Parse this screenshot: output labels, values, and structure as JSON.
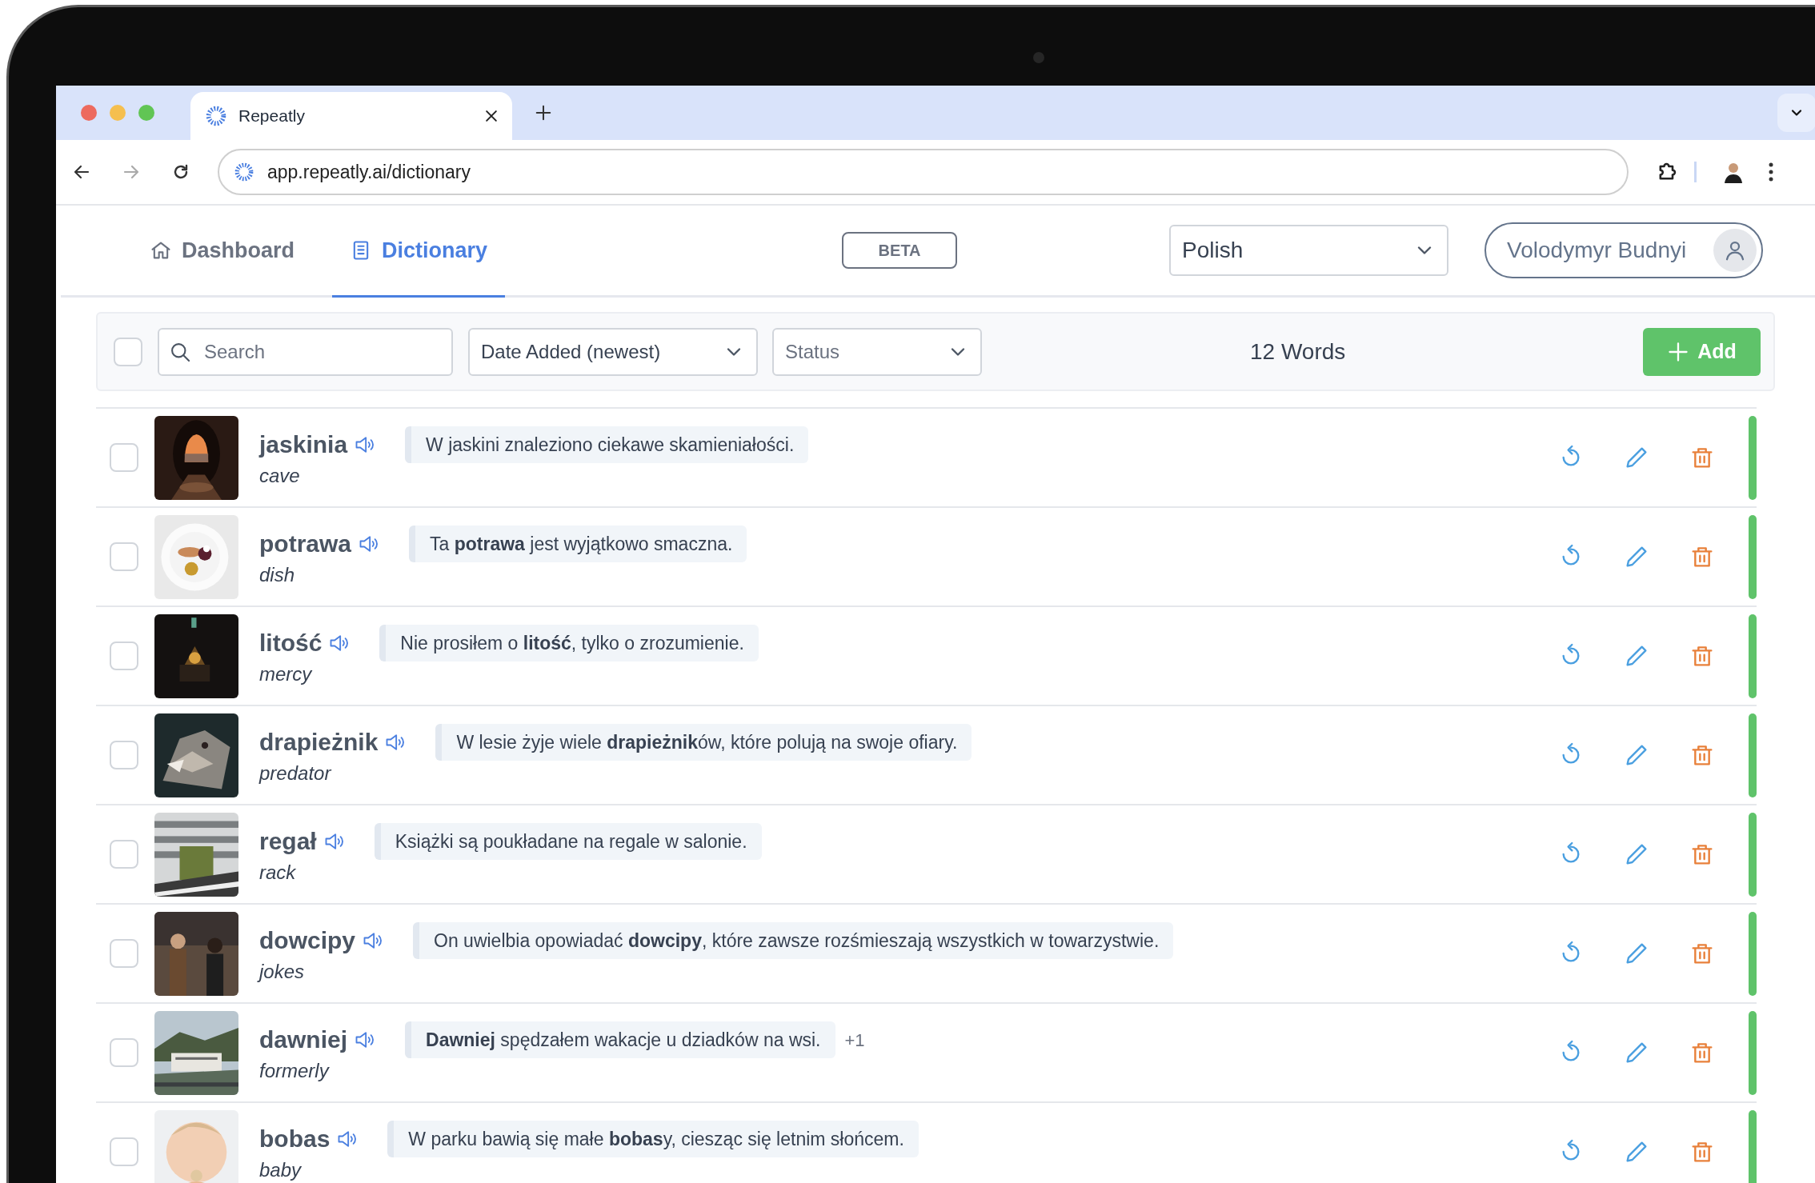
{
  "browser": {
    "tab": {
      "title": "Repeatly"
    },
    "url": "app.repeatly.ai/dictionary"
  },
  "nav": {
    "items": [
      {
        "label": "Dashboard",
        "kind": "home",
        "selected": false
      },
      {
        "label": "Dictionary",
        "kind": "book",
        "selected": true
      }
    ],
    "badge": "BETA",
    "language": "Polish",
    "user": "Volodymyr Budnyi"
  },
  "toolbar": {
    "select_all_checked": false,
    "search": {
      "placeholder": "Search"
    },
    "sort": "Date Added (newest)",
    "status": {
      "placeholder": "Status"
    },
    "count": "12 Words",
    "add_button": "Add"
  },
  "words": [
    {
      "word": "jaskinia",
      "translation": "cave",
      "example": "W jaskini znaleziono ciekawe skamieniałości.",
      "checked": false,
      "color": "#5fc36a"
    },
    {
      "word": "potrawa",
      "translation": "dish",
      "example": "Ta **potrawa** jest wyjątkowo smaczna.",
      "checked": false,
      "color": "#5fc36a"
    },
    {
      "word": "litość",
      "translation": "mercy",
      "example": "Nie prosiłem o **litość**, tylko o zrozumienie.",
      "checked": false,
      "color": "#5fc36a"
    },
    {
      "word": "drapieżnik",
      "translation": "predator",
      "example": "W lesie żyje wiele **drapieżnik**ów, które polują na swoje ofiary.",
      "checked": false,
      "color": "#5fc36a"
    },
    {
      "word": "regał",
      "translation": "rack",
      "example": "Książki są poukładane na regale w salonie.",
      "checked": false,
      "color": "#5fc36a"
    },
    {
      "word": "dowcipy",
      "translation": "jokes",
      "example": "On uwielbia opowiadać **dowcipy**, które zawsze rozśmieszają wszystkich w towarzystwie.",
      "checked": false,
      "color": "#5fc36a"
    },
    {
      "word": "dawniej",
      "translation": "formerly",
      "example": "**Dawniej** spędzałem wakacje u dziadków na wsi.",
      "more": "+1",
      "checked": false,
      "color": "#5fc36a"
    },
    {
      "word": "bobas",
      "translation": "baby",
      "example": "W parku bawią się małe **bobas**y, ciesząc się letnim słońcem.",
      "checked": false,
      "color": "#5fc36a"
    }
  ]
}
